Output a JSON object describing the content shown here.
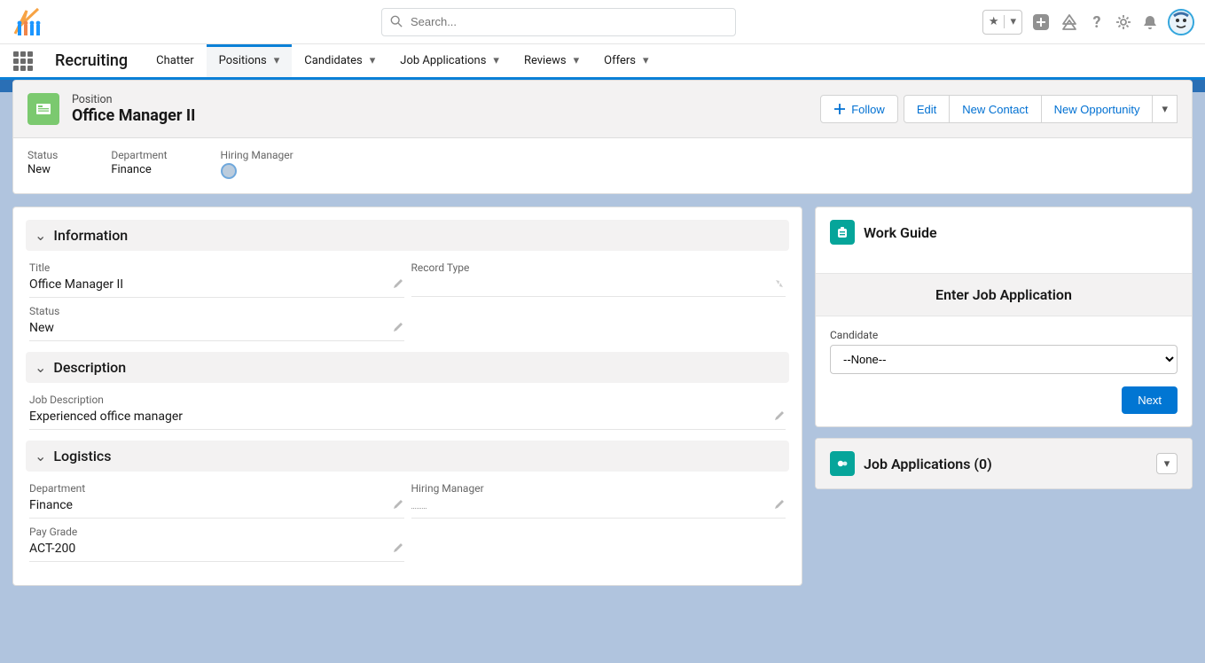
{
  "app_name": "Recruiting",
  "search_placeholder": "Search...",
  "nav": {
    "items": [
      {
        "label": "Chatter"
      },
      {
        "label": "Positions"
      },
      {
        "label": "Candidates"
      },
      {
        "label": "Job Applications"
      },
      {
        "label": "Reviews"
      },
      {
        "label": "Offers"
      }
    ]
  },
  "record": {
    "object_label": "Position",
    "title": "Office Manager II",
    "actions": {
      "follow": "Follow",
      "edit": "Edit",
      "new_contact": "New Contact",
      "new_opportunity": "New Opportunity"
    },
    "highlights": {
      "status_label": "Status",
      "status_value": "New",
      "department_label": "Department",
      "department_value": "Finance",
      "hiring_manager_label": "Hiring Manager"
    }
  },
  "detail": {
    "section_information": "Information",
    "title_label": "Title",
    "title_value": "Office Manager II",
    "record_type_label": "Record Type",
    "status_label": "Status",
    "status_value": "New",
    "section_description": "Description",
    "job_description_label": "Job Description",
    "job_description_value": "Experienced office manager",
    "section_logistics": "Logistics",
    "department_label": "Department",
    "department_value": "Finance",
    "hiring_manager_label": "Hiring Manager",
    "pay_grade_label": "Pay Grade",
    "pay_grade_value": "ACT-200"
  },
  "work_guide": {
    "title": "Work Guide",
    "step_title": "Enter Job Application",
    "candidate_label": "Candidate",
    "candidate_value": "--None--",
    "next_label": "Next"
  },
  "related": {
    "job_applications_label": "Job Applications (0)"
  }
}
